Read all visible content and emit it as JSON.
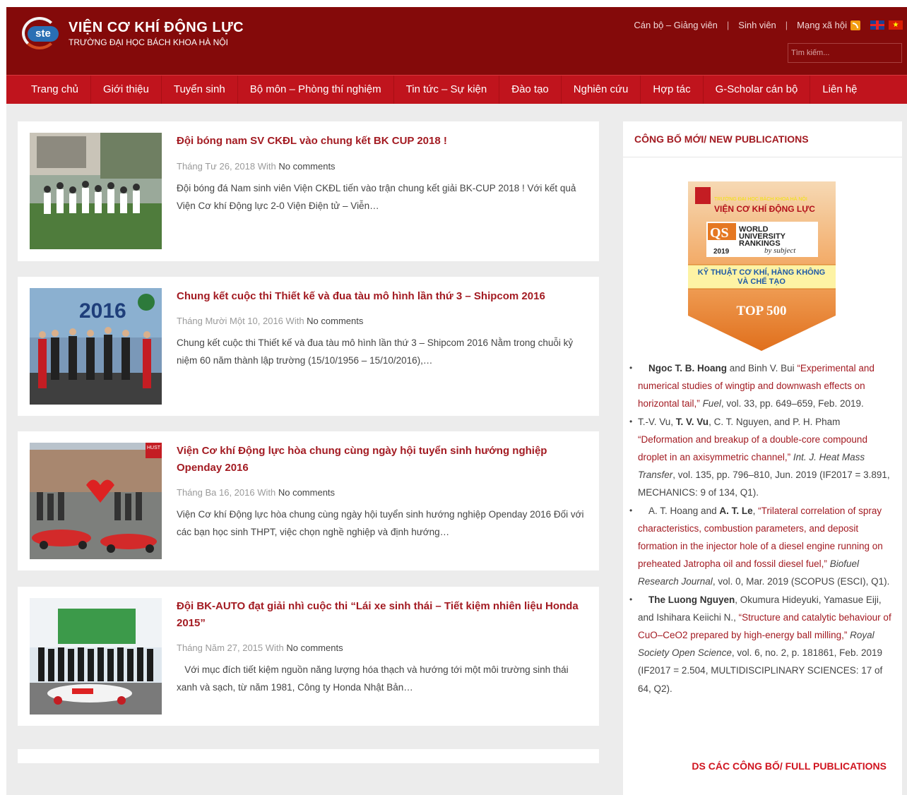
{
  "header": {
    "logo_badge": "ste",
    "title": "VIỆN CƠ KHÍ ĐỘNG LỰC",
    "subtitle": "TRƯỜNG ĐẠI HỌC BÁCH KHOA HÀ NỘI",
    "toplinks": [
      "Cán bộ – Giảng viên",
      "Sinh viên",
      "Mạng xã hội"
    ],
    "separator": "|",
    "search_placeholder": "Tìm kiếm...",
    "colors": {
      "header_bg": "#840a0a",
      "nav_bg": "#c0141d",
      "accent": "#a31b22"
    }
  },
  "nav": {
    "items": [
      "Trang chủ",
      "Giới thiệu",
      "Tuyển sinh",
      "Bộ môn – Phòng thí nghiệm",
      "Tin tức – Sự kiện",
      "Đào tạo",
      "Nghiên cứu",
      "Hợp tác",
      "G-Scholar cán bộ",
      "Liên hệ"
    ]
  },
  "posts": [
    {
      "title": "Đội bóng nam SV CKĐL vào chung kết BK CUP 2018 !",
      "date": "Tháng Tư 26, 2018",
      "with": "With",
      "comments": "No comments",
      "excerpt": "Đội bóng đá Nam sinh viên Viện CKĐL tiến vào trận chung kết giải BK-CUP 2018 ! Với kết quả Viện Cơ khí Động lực 2-0 Viện Điện tử – Viễn…"
    },
    {
      "title": "Chung kết cuộc thi Thiết kế và đua tàu mô hình lần thứ 3 – Shipcom 2016",
      "date": "Tháng Mười Một 10, 2016",
      "with": "With",
      "comments": "No comments",
      "excerpt": "Chung kết cuộc thi Thiết kế và đua tàu mô hình lần thứ 3 – Shipcom 2016 Nằm trong chuỗi kỷ niệm 60 năm thành lập trường (15/10/1956 – 15/10/2016),…"
    },
    {
      "title": "Viện Cơ khí Động lực hòa chung cùng ngày hội tuyển sinh hướng nghiệp Openday 2016",
      "date": "Tháng Ba 16, 2016",
      "with": "With",
      "comments": "No comments",
      "excerpt": "Viện Cơ khí Động lực hòa chung cùng ngày hội tuyển sinh hướng nghiệp Openday 2016 Đối với các bạn học sinh THPT, việc chọn nghề nghiệp và định hướng…"
    },
    {
      "title": "Đội BK-AUTO đạt giải nhì cuộc thi “Lái xe sinh thái – Tiết kiệm nhiên liệu Honda 2015”",
      "date": "Tháng Năm 27, 2015",
      "with": "With",
      "comments": "No comments",
      "excerpt": "   Với mục đích tiết kiệm nguồn năng lượng hóa thạch và hướng tới một môi trường sinh thái xanh và sạch, từ năm 1981, Công ty Honda Nhật Bản…"
    }
  ],
  "thumb_labels": {
    "shipcom": "2016",
    "openday": "HUST"
  },
  "sidebar": {
    "heading": "CÔNG BỐ MỚI/ NEW PUBLICATIONS",
    "qs_badge": {
      "school": "TRƯỜNG ĐẠI HỌC BÁCH KHOA HÀ NỘI",
      "institute": "VIỆN CƠ KHÍ ĐỘNG LỰC",
      "qs": "QS",
      "world": "WORLD",
      "university": "UNIVERSITY",
      "rankings": "RANKINGS",
      "by_subject": "by subject",
      "year": "2019",
      "field": "KỸ THUẬT CƠ KHÍ, HÀNG KHÔNG VÀ CHẾ TẠO",
      "rank": "TOP 500"
    },
    "publications": [
      {
        "authors_bold": "Ngoc T. B. Hoang",
        "authors_rest": " and Binh V. Bui ",
        "title": "“Experimental and numerical studies of wingtip and downwash effects on horizontal tail,”",
        "journal": "Fuel",
        "details": ", vol. 33, pp. 649–659, Feb. 2019."
      },
      {
        "authors_pre": "T.-V. Vu, ",
        "authors_bold": "T. V. Vu",
        "authors_rest": ", C. T. Nguyen, and P. H. Pham ",
        "title": "“Deformation and breakup of a double-core compound droplet in an axisymmetric channel,”",
        "journal": "Int. J. Heat Mass Transfer",
        "details": ", vol. 135, pp. 796–810, Jun. 2019 (IF2017 = 3.891, MECHANICS: 9 of 134, Q1)."
      },
      {
        "authors_pre": "A. T. Hoang and ",
        "authors_bold": "A. T. Le",
        "authors_rest": ", ",
        "title": "“Trilateral correlation of spray characteristics, combustion parameters, and deposit formation in the injector hole of a diesel engine running on preheated Jatropha oil and fossil diesel fuel,”",
        "journal": "Biofuel Research Journal",
        "details": ", vol. 0, Mar. 2019 (SCOPUS (ESCI), Q1)."
      },
      {
        "authors_bold": "The Luong Nguyen",
        "authors_rest": ", Okumura Hideyuki, Yamasue Eiji, and Ishihara Keiichi N., ",
        "title": "“Structure and catalytic behaviour of CuO–CeO2 prepared by high-energy ball milling,”",
        "journal": "Royal Society Open Science",
        "details": ", vol. 6, no. 2, p. 181861, Feb. 2019 (IF2017 = 2.504, MULTIDISCIPLINARY SCIENCES: 17 of 64, Q2)."
      }
    ],
    "full_link": "DS CÁC CÔNG BỐ/ FULL PUBLICATIONS"
  }
}
